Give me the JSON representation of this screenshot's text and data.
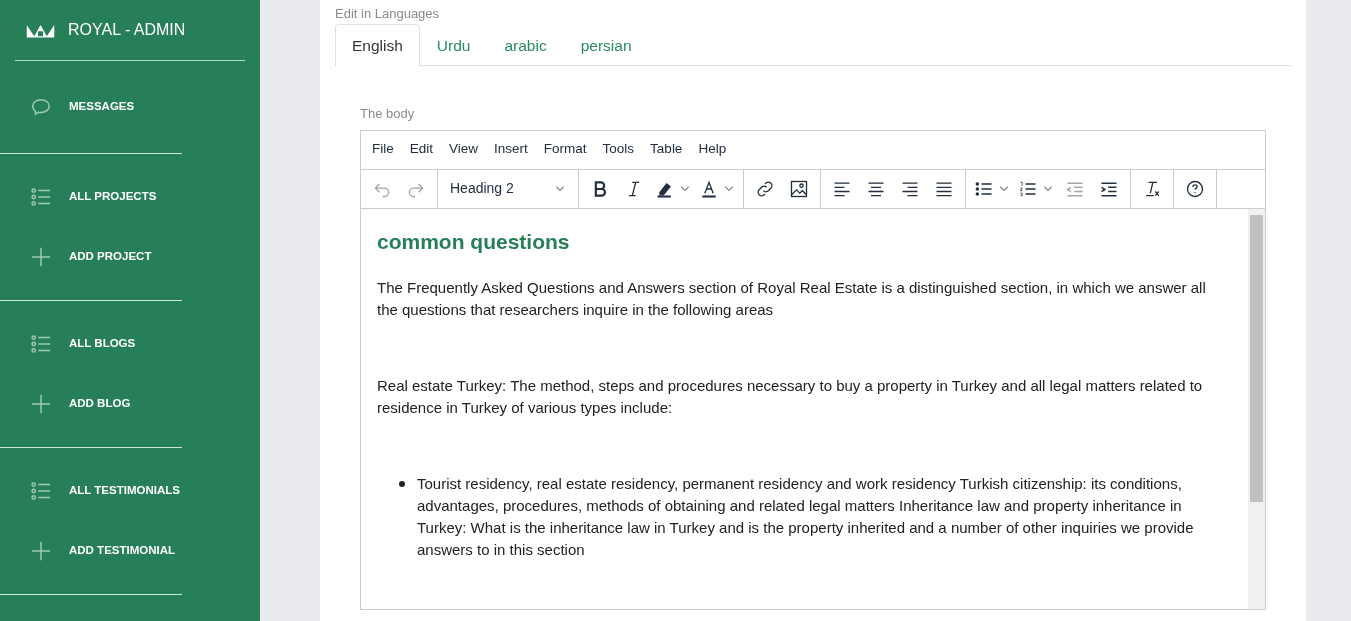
{
  "sidebar": {
    "brand": "ROYAL - ADMIN",
    "groups": [
      [
        {
          "kind": "chat",
          "label": "MESSAGES"
        }
      ],
      [
        {
          "kind": "list",
          "label": "ALL PROJECTS"
        },
        {
          "kind": "plus",
          "label": "ADD PROJECT"
        }
      ],
      [
        {
          "kind": "list",
          "label": "ALL BLOGS"
        },
        {
          "kind": "plus",
          "label": "ADD BLOG"
        }
      ],
      [
        {
          "kind": "list",
          "label": "ALL TESTIMONIALS"
        },
        {
          "kind": "plus",
          "label": "ADD TESTIMONIAL"
        }
      ]
    ]
  },
  "section_label": "Edit in Languages",
  "tabs": [
    {
      "label": "English",
      "selected": true
    },
    {
      "label": "Urdu",
      "selected": false
    },
    {
      "label": "arabic",
      "selected": false
    },
    {
      "label": "persian",
      "selected": false
    }
  ],
  "editor": {
    "label": "The body",
    "menu": [
      "File",
      "Edit",
      "View",
      "Insert",
      "Format",
      "Tools",
      "Table",
      "Help"
    ],
    "toolbar": [
      [
        {
          "kind": "undo",
          "disabled": true
        },
        {
          "kind": "redo",
          "disabled": true
        }
      ],
      [
        {
          "kind": "select",
          "value": "Heading 2",
          "disabled": false
        }
      ],
      [
        {
          "kind": "bold",
          "disabled": false
        },
        {
          "kind": "italic",
          "disabled": false
        },
        {
          "kind": "highlight",
          "disabled": false
        },
        {
          "kind": "textcolor",
          "disabled": false
        }
      ],
      [
        {
          "kind": "link",
          "disabled": false
        },
        {
          "kind": "image",
          "disabled": false
        }
      ],
      [
        {
          "kind": "alignleft",
          "disabled": false
        },
        {
          "kind": "aligncenter",
          "disabled": false
        },
        {
          "kind": "alignright",
          "disabled": false
        },
        {
          "kind": "justify",
          "disabled": false
        }
      ],
      [
        {
          "kind": "bullist",
          "disabled": false
        },
        {
          "kind": "numlist",
          "disabled": false
        },
        {
          "kind": "outdent",
          "disabled": true
        },
        {
          "kind": "indent",
          "disabled": false
        }
      ],
      [
        {
          "kind": "clearformat",
          "disabled": false
        }
      ],
      [
        {
          "kind": "help",
          "disabled": false
        }
      ]
    ],
    "content": [
      {
        "kind": "heading",
        "text": "common questions"
      },
      {
        "kind": "paragraph",
        "text": "The Frequently Asked Questions and Answers section of Royal Real Estate is a distinguished section, in which we answer all the questions that researchers inquire in the following areas"
      },
      {
        "kind": "paragraph",
        "text": "Real estate Turkey: The method, steps and procedures necessary to buy a property in Turkey and all legal matters related to residence in Turkey of various types include:"
      },
      {
        "kind": "bullet",
        "text": " Tourist residency, real estate residency, permanent residency and work residency Turkish citizenship: its conditions, advantages, procedures, methods of obtaining and related legal matters Inheritance law and property inheritance in Turkey: What is the inheritance law in Turkey and is the property inherited and a number of other inquiries we provide answers to in this section"
      }
    ]
  }
}
